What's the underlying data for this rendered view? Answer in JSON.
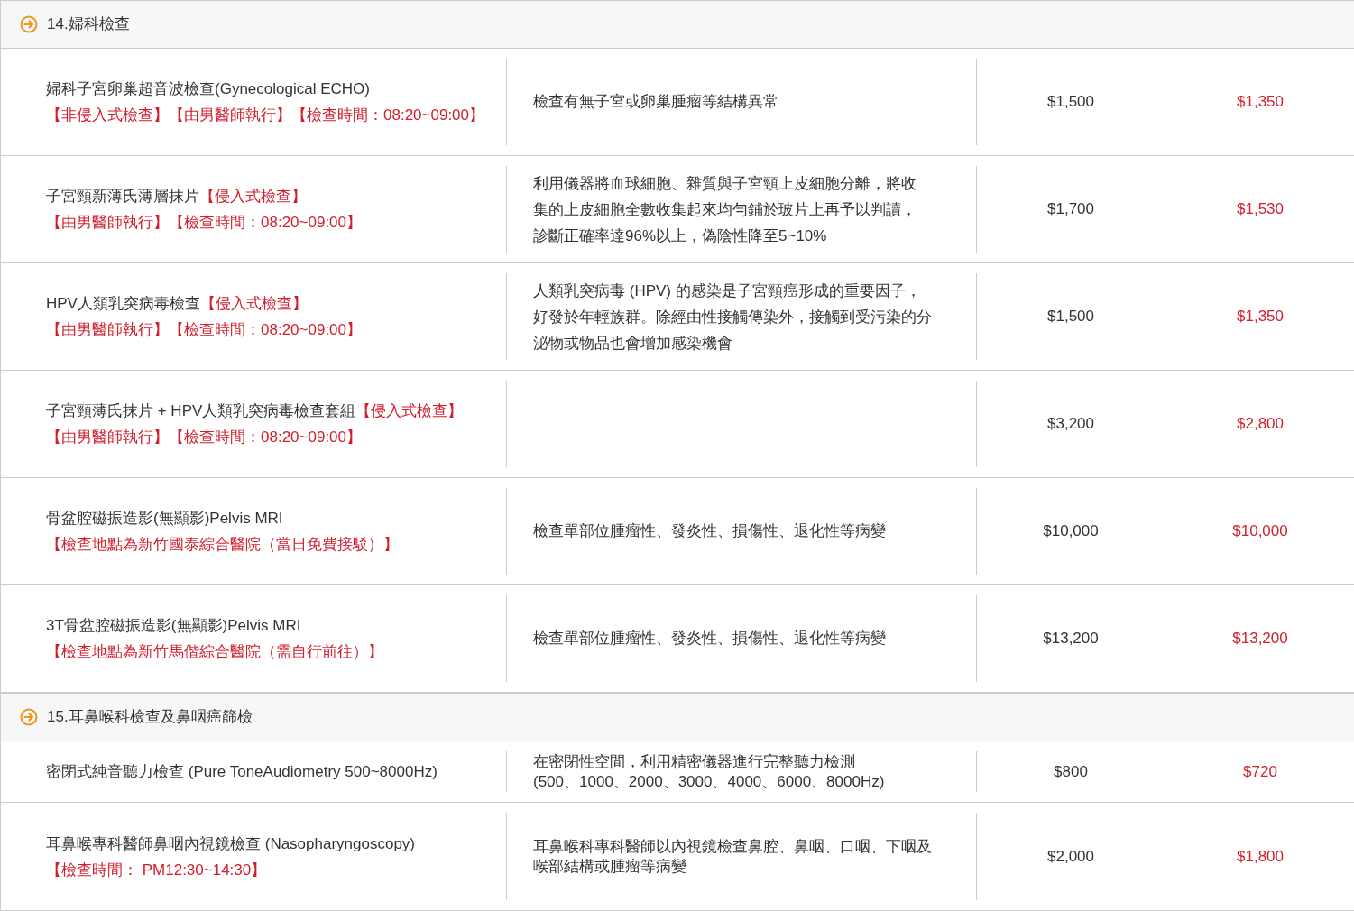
{
  "sections": [
    {
      "title": "14.婦科檢查",
      "rows": [
        {
          "name": [
            [
              {
                "text": "婦科子宮卵巢超音波檢查(Gynecological ECHO)",
                "kind": "plain"
              }
            ],
            [
              {
                "text": "【非侵入式檢查】【由男醫師執行】【檢查時間：08:20~09:00】",
                "kind": "tag"
              }
            ]
          ],
          "description": [
            "檢查有無子宮或卵巢腫瘤等結構異常"
          ],
          "price": "$1,500",
          "discount_price": "$1,350"
        },
        {
          "name": [
            [
              {
                "text": "子宮頸新薄氏薄層抹片",
                "kind": "plain"
              },
              {
                "text": "【侵入式檢查】",
                "kind": "tag"
              }
            ],
            [
              {
                "text": "【由男醫師執行】【檢查時間：08:20~09:00】",
                "kind": "tag"
              }
            ]
          ],
          "description": [
            "利用儀器將血球細胞、雜質與子宮頸上皮細胞分離，將收",
            "集的上皮細胞全數收集起來均勻鋪於玻片上再予以判讀，",
            "診斷正確率達96%以上，偽陰性降至5~10%"
          ],
          "price": "$1,700",
          "discount_price": "$1,530"
        },
        {
          "name": [
            [
              {
                "text": "HPV人類乳突病毒檢查",
                "kind": "plain"
              },
              {
                "text": "【侵入式檢查】",
                "kind": "tag"
              }
            ],
            [
              {
                "text": "【由男醫師執行】【檢查時間：08:20~09:00】",
                "kind": "tag"
              }
            ]
          ],
          "description": [
            "人類乳突病毒 (HPV) 的感染是子宮頸癌形成的重要因子，",
            "好發於年輕族群。除經由性接觸傳染外，接觸到受污染的分",
            "泌物或物品也會增加感染機會"
          ],
          "price": "$1,500",
          "discount_price": "$1,350"
        },
        {
          "name": [
            [
              {
                "text": "子宮頸薄氏抹片 + HPV人類乳突病毒檢查套組",
                "kind": "plain"
              },
              {
                "text": "【侵入式檢查】",
                "kind": "tag"
              }
            ],
            [
              {
                "text": "【由男醫師執行】【檢查時間：08:20~09:00】",
                "kind": "tag"
              }
            ]
          ],
          "price": "$3,200",
          "discount_price": "$2,800"
        },
        {
          "name": [
            [
              {
                "text": "骨盆腔磁振造影(無顯影)Pelvis MRI",
                "kind": "plain"
              }
            ],
            [
              {
                "text": "【檢查地點為新竹國泰綜合醫院（當日免費接駁）】",
                "kind": "tag"
              }
            ]
          ],
          "description": [
            "檢查單部位腫瘤性、發炎性、損傷性、退化性等病變"
          ],
          "price": "$10,000",
          "discount_price": "$10,000"
        },
        {
          "name": [
            [
              {
                "text": "3T骨盆腔磁振造影(無顯影)Pelvis MRI",
                "kind": "plain"
              }
            ],
            [
              {
                "text": "【檢查地點為新竹馬偕綜合醫院（需自行前往）】",
                "kind": "tag"
              }
            ]
          ],
          "description": [
            "檢查單部位腫瘤性、發炎性、損傷性、退化性等病變"
          ],
          "price": "$13,200",
          "discount_price": "$13,200"
        }
      ]
    },
    {
      "title": "15.耳鼻喉科檢查及鼻咽癌篩檢",
      "rows": [
        {
          "name": [
            [
              {
                "text": "密閉式純音聽力檢查 (Pure ToneAudiometry 500~8000Hz)",
                "kind": "plain"
              }
            ]
          ],
          "description": [
            "在密閉性空間，利用精密儀器進行完整聽力檢測",
            "(500、1000、2000、3000、4000、6000、8000Hz)"
          ],
          "price": "$800",
          "discount_price": "$720"
        },
        {
          "name": [
            [
              {
                "text": "耳鼻喉專科醫師鼻咽內視鏡檢查 (Nasopharyngoscopy)",
                "kind": "plain"
              }
            ],
            [
              {
                "text": "【檢查時間： PM12:30~14:30】",
                "kind": "tag"
              }
            ]
          ],
          "description": [
            "耳鼻喉科專科醫師以內視鏡檢查鼻腔、鼻咽、口咽、下咽及",
            "喉部結構或腫瘤等病變"
          ],
          "price": "$2,000",
          "discount_price": "$1,800"
        }
      ]
    }
  ]
}
